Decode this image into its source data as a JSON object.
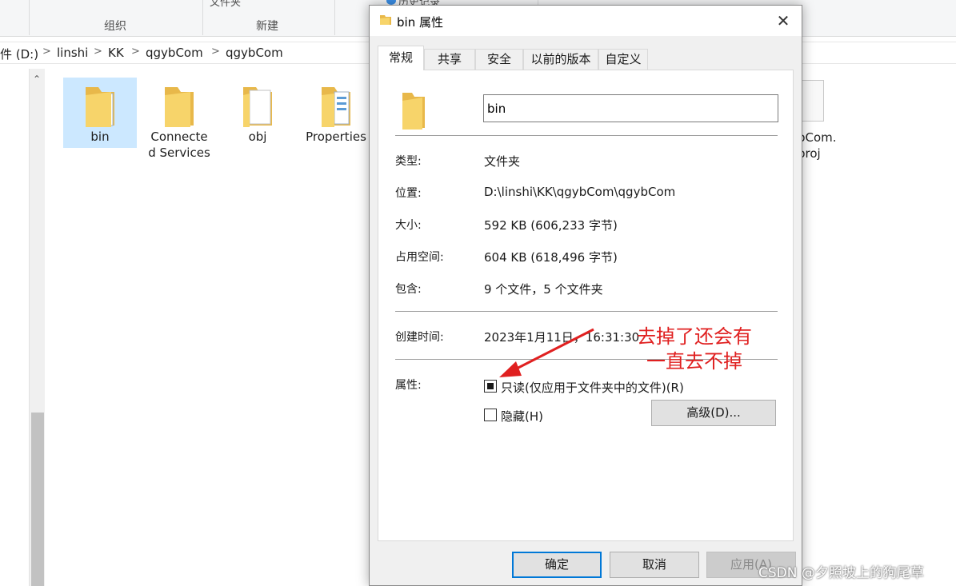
{
  "ribbon": {
    "group_organize": "组织",
    "group_new": "新建",
    "new_folder_label": "文件夹",
    "history_label": "历史记录"
  },
  "breadcrumb": [
    "件 (D:)",
    "linshi",
    "KK",
    "qgybCom",
    "qgybCom"
  ],
  "files": [
    {
      "label": "bin",
      "selected": true
    },
    {
      "label": "Connecte\nd Services"
    },
    {
      "label": "obj"
    },
    {
      "label": "Properties"
    }
  ],
  "partial_file_label": "bCom.\nproj",
  "dialog": {
    "title": "bin 属性",
    "close_glyph": "✕",
    "tabs": [
      "常规",
      "共享",
      "安全",
      "以前的版本",
      "自定义"
    ],
    "name_value": "bin",
    "props": {
      "type_label": "类型:",
      "type_value": "文件夹",
      "location_label": "位置:",
      "location_value": "D:\\linshi\\KK\\qgybCom\\qgybCom",
      "size_label": "大小:",
      "size_value": "592 KB (606,233 字节)",
      "disk_label": "占用空间:",
      "disk_value": "604 KB (618,496 字节)",
      "contains_label": "包含:",
      "contains_value": "9 个文件，5 个文件夹",
      "created_label": "创建时间:",
      "created_value": "2023年1月11日，16:31:30",
      "attributes_label": "属性:"
    },
    "readonly_label": "只读(仅应用于文件夹中的文件)(R)",
    "readonly_state": "indeterminate",
    "hidden_label": "隐藏(H)",
    "hidden_checked": false,
    "advanced_label": "高级(D)...",
    "ok_label": "确定",
    "cancel_label": "取消",
    "apply_label": "应用(A)"
  },
  "annotation": {
    "line1": "去掉了还会有",
    "line2": "一直去不掉",
    "color": "#e02020"
  },
  "watermark": "CSDN @夕照坡上的狗尾草",
  "colors": {
    "folder": "#f7d46a",
    "selection": "#cce8ff",
    "default_button_border": "#0078d7"
  }
}
